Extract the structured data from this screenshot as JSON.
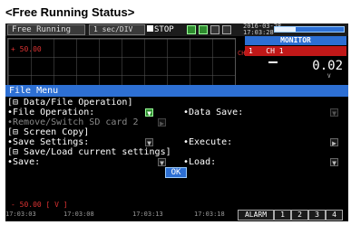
{
  "caption": "<Free Running Status>",
  "status_bar": {
    "mode": "Free Running",
    "rate": "1 sec/DIV",
    "state": "STOP",
    "date": "2016-03-28",
    "time": "17:03:28",
    "level_fill": 0.3
  },
  "monitor": {
    "title": "MONITOR",
    "channel_num": "1",
    "channel_label": "CH 1",
    "value": "0.02",
    "unit": "V"
  },
  "graph": {
    "top_label": "+ 50.00",
    "ch_marker": "CH",
    "bottom_label": "- 50.00 [ V ]",
    "time_ticks": [
      "17:03:03",
      "17:03:08",
      "17:03:13",
      "17:03:18"
    ]
  },
  "alarm_row": {
    "label": "ALARM",
    "cells": [
      "1",
      "2",
      "3",
      "4"
    ]
  },
  "file_menu": {
    "title": "File Menu",
    "section_data": "[⊟ Data/File Operation]",
    "file_operation": "•File Operation:",
    "data_save": "•Data Save:",
    "remove_sd": "•Remove/Switch SD card 2",
    "section_screen": "[⊟ Screen Copy]",
    "save_settings": "•Save Settings:",
    "execute": "•Execute:",
    "section_saveload": "[⊟ Save/Load current settings]",
    "save": "•Save:",
    "load": "•Load:",
    "ok": "OK"
  },
  "colors": {
    "accent_blue": "#2d6fd3",
    "channel_red": "#c01818",
    "active_green": "#2e8b2e"
  }
}
